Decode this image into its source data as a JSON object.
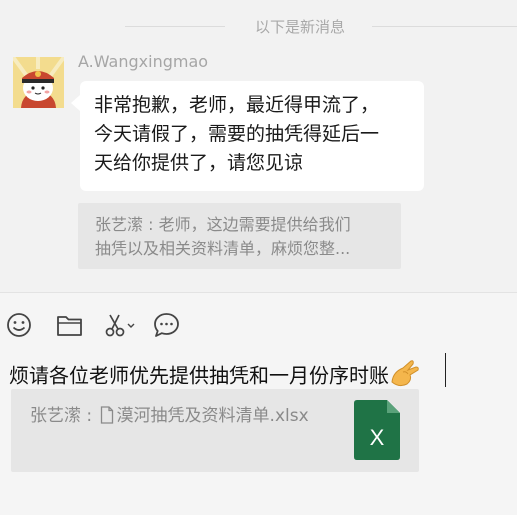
{
  "divider": {
    "label": "以下是新消息"
  },
  "message": {
    "sender": "A.Wangxingmao",
    "lines": [
      "非常抱歉，老师，最近得甲流了，",
      "今天请假了，需要的抽凭得延后一",
      "天给你提供了，请您见谅"
    ]
  },
  "quote": {
    "line1": "张艺潆 : 老师，这边需要提供给我们",
    "line2": "抽凭以及相关资料清单，麻烦您整..."
  },
  "toolbar": {
    "items": [
      {
        "name": "emoji-icon"
      },
      {
        "name": "folder-icon"
      },
      {
        "name": "scissors-icon"
      },
      {
        "name": "chat-bubble-icon"
      }
    ]
  },
  "compose": {
    "text": "烦请各位老师优先提供抽凭和一月份序时账",
    "emoji": "pinched-hand-emoji"
  },
  "file_quote": {
    "prefix": "张艺潆 : ",
    "filename": "漠河抽凭及资料清单.xlsx",
    "icon_letter": "X",
    "icon_color": "#1f7346"
  }
}
